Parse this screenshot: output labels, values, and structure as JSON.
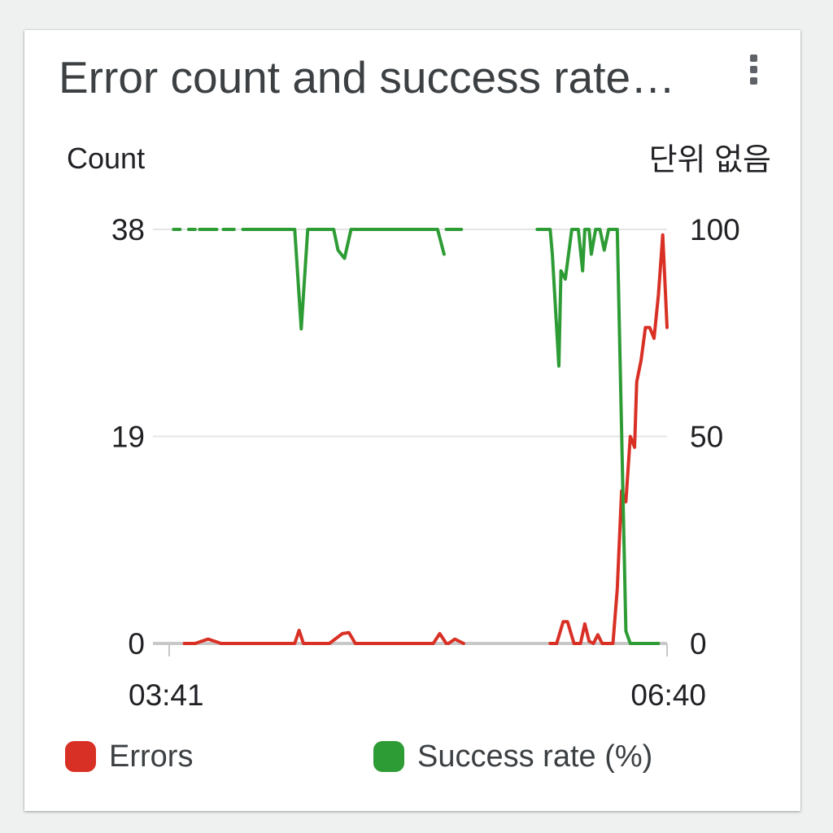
{
  "widget": {
    "title": "Error count and success rate…",
    "menu_icon": "more-vert-icon"
  },
  "chart_data": {
    "type": "line",
    "title": "Error count and success rate…",
    "xlabel": "",
    "x_tick_labels": [
      "03:41",
      "06:40"
    ],
    "y_left": {
      "label": "Count",
      "ticks": [
        0,
        19,
        38
      ],
      "range": [
        0,
        38
      ]
    },
    "y_right": {
      "label": "단위 없음",
      "ticks": [
        0,
        50,
        100
      ],
      "range": [
        0,
        100
      ]
    },
    "grid": true,
    "legend_position": "bottom",
    "series": [
      {
        "name": "Errors",
        "axis": "left",
        "color": "#d93025",
        "points": [
          [
            3.5,
            0
          ],
          [
            6,
            0
          ],
          [
            9,
            0.4
          ],
          [
            12,
            0
          ],
          [
            16,
            0
          ],
          [
            21,
            0
          ],
          [
            27,
            0
          ],
          [
            29,
            0
          ],
          [
            30,
            1.2
          ],
          [
            31,
            0
          ],
          [
            37,
            0
          ],
          [
            40,
            0.9
          ],
          [
            41.5,
            1
          ],
          [
            43,
            0
          ],
          [
            50,
            0
          ],
          [
            57,
            0
          ],
          [
            61,
            0
          ],
          [
            62.5,
            0.9
          ],
          [
            64,
            0
          ],
          [
            null,
            null
          ],
          [
            64.5,
            0
          ],
          [
            66,
            0.4
          ],
          [
            68,
            0
          ],
          [
            null,
            null
          ],
          [
            88,
            0
          ],
          [
            89.5,
            0
          ],
          [
            91,
            2
          ],
          [
            92,
            2
          ],
          [
            93.5,
            0
          ],
          [
            95,
            0
          ],
          [
            96,
            1.8
          ],
          [
            97,
            0.2
          ],
          [
            98,
            0
          ],
          [
            99,
            0.8
          ],
          [
            100,
            0
          ],
          [
            102.5,
            0
          ],
          [
            103.5,
            5
          ],
          [
            104.5,
            14
          ],
          [
            105.5,
            13
          ],
          [
            106.5,
            19
          ],
          [
            107.5,
            18
          ],
          [
            108,
            24
          ],
          [
            109,
            26
          ],
          [
            110,
            29
          ],
          [
            111,
            29
          ],
          [
            112,
            28
          ],
          [
            113,
            32
          ],
          [
            114,
            37.5
          ],
          [
            115,
            29
          ]
        ]
      },
      {
        "name": "Success rate (%)",
        "axis": "right",
        "color": "#2e9c35",
        "points": [
          [
            1,
            100
          ],
          [
            2.5,
            100
          ],
          [
            null,
            null
          ],
          [
            4.5,
            100
          ],
          [
            6,
            100
          ],
          [
            null,
            null
          ],
          [
            7,
            100
          ],
          [
            9.5,
            100
          ],
          [
            11,
            100
          ],
          [
            null,
            null
          ],
          [
            12.5,
            100
          ],
          [
            15,
            100
          ],
          [
            null,
            null
          ],
          [
            17,
            100
          ],
          [
            24,
            100
          ],
          [
            25.5,
            100
          ],
          [
            27.5,
            100
          ],
          [
            29,
            100
          ],
          [
            30.5,
            76
          ],
          [
            32,
            100
          ],
          [
            38,
            100
          ],
          [
            39,
            95
          ],
          [
            40.5,
            93
          ],
          [
            42,
            100
          ],
          [
            49,
            100
          ],
          [
            55,
            100
          ],
          [
            60,
            100
          ],
          [
            62,
            100
          ],
          [
            63.5,
            94
          ],
          [
            null,
            null
          ],
          [
            64,
            100
          ],
          [
            66,
            100
          ],
          [
            67.5,
            100
          ],
          [
            null,
            null
          ],
          [
            85,
            100
          ],
          [
            88,
            100
          ],
          [
            88.5,
            94
          ],
          [
            90,
            67
          ],
          [
            90.5,
            90
          ],
          [
            91.5,
            88
          ],
          [
            93,
            100
          ],
          [
            94.5,
            100
          ],
          [
            95.5,
            90
          ],
          [
            96,
            100
          ],
          [
            97,
            100
          ],
          [
            97.5,
            94
          ],
          [
            98.5,
            100
          ],
          [
            99.5,
            100
          ],
          [
            100.5,
            95
          ],
          [
            101.5,
            100
          ],
          [
            103.5,
            100
          ],
          [
            105.5,
            3
          ],
          [
            106.5,
            0
          ],
          [
            112,
            0
          ],
          [
            113,
            0
          ]
        ]
      }
    ]
  }
}
